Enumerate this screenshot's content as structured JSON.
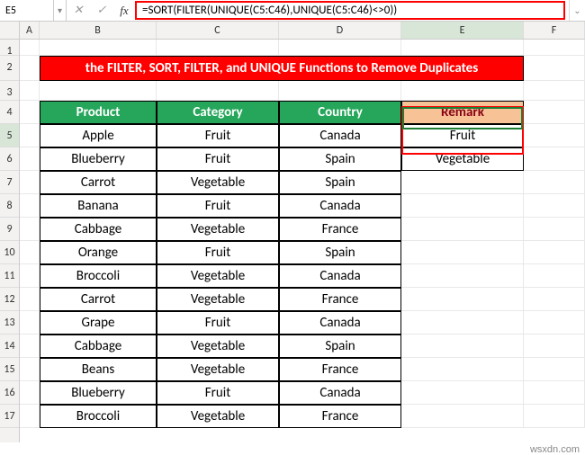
{
  "nameBox": "E5",
  "formula": "=SORT(FILTER(UNIQUE(C5:C46),UNIQUE(C5:C46)<>0))",
  "columns": [
    "A",
    "B",
    "C",
    "D",
    "E",
    "F"
  ],
  "colWidths": {
    "A": 22,
    "B": 130,
    "C": 136,
    "D": 136,
    "E": 136,
    "F": 68
  },
  "rows": [
    "1",
    "2",
    "3",
    "4",
    "5",
    "6",
    "7",
    "8",
    "9",
    "10",
    "11",
    "12",
    "13",
    "14",
    "15",
    "16",
    "17"
  ],
  "activeCol": "E",
  "activeRow": "5",
  "title": "the FILTER, SORT, FILTER, and UNIQUE Functions to Remove Duplicates",
  "headers": {
    "product": "Product",
    "category": "Category",
    "country": "Country",
    "remark": "Remark"
  },
  "table": [
    {
      "product": "Apple",
      "category": "Fruit",
      "country": "Canada"
    },
    {
      "product": "Blueberry",
      "category": "Fruit",
      "country": "Spain"
    },
    {
      "product": "Carrot",
      "category": "Vegetable",
      "country": "Spain"
    },
    {
      "product": "Banana",
      "category": "Fruit",
      "country": "Canada"
    },
    {
      "product": "Cabbage",
      "category": "Vegetable",
      "country": "France"
    },
    {
      "product": "Orange",
      "category": "Fruit",
      "country": "Spain"
    },
    {
      "product": "Broccoli",
      "category": "Vegetable",
      "country": "Canada"
    },
    {
      "product": "Carrot",
      "category": "Vegetable",
      "country": "France"
    },
    {
      "product": "Grape",
      "category": "Fruit",
      "country": "Canada"
    },
    {
      "product": "Cabbage",
      "category": "Vegetable",
      "country": "Spain"
    },
    {
      "product": "Beans",
      "category": "Vegetable",
      "country": "France"
    },
    {
      "product": "Blueberry",
      "category": "Fruit",
      "country": "Canada"
    },
    {
      "product": "Broccoli",
      "category": "Vegetable",
      "country": "France"
    }
  ],
  "remarks": [
    "Fruit",
    "Vegetable"
  ],
  "watermark": "wsxdn.com"
}
